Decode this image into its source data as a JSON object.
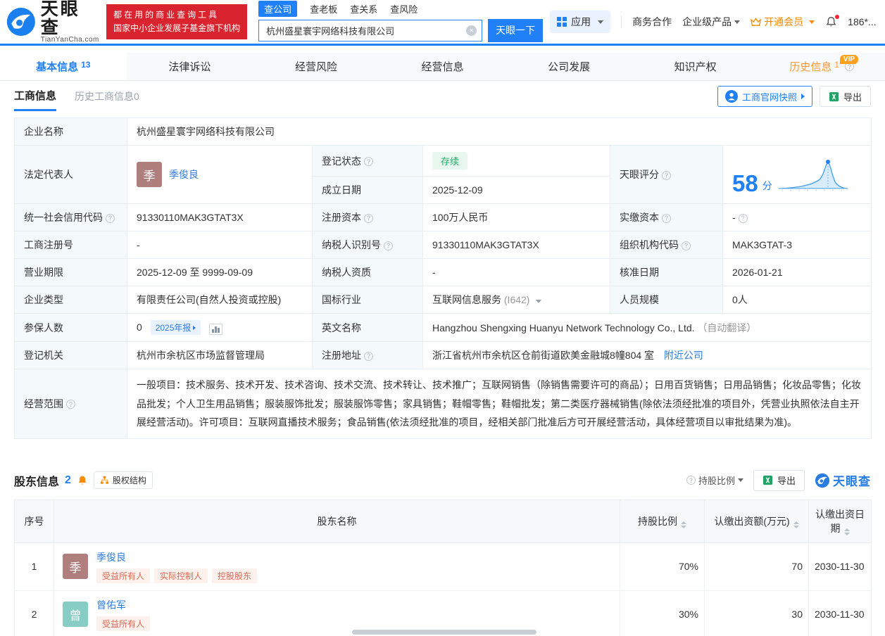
{
  "colors": {
    "primary_blue": "#2080f7",
    "link_blue": "#2d7ce0",
    "slogan_red": "#d9232e",
    "vip_orange": "#ff8a00",
    "status_green": "#21ac67",
    "avatar_brown": "#ae7f7c",
    "avatar_teal": "#87cdc6",
    "tag_orange": "#dd6a55"
  },
  "header": {
    "brand": "天眼查",
    "brand_domain": "TianYanCha.com",
    "slogan_line1": "都在用的商业查询工具",
    "slogan_line2": "国家中小企业发展子基金旗下机构",
    "search_tabs": [
      {
        "label": "查公司",
        "active": true
      },
      {
        "label": "查老板",
        "active": false
      },
      {
        "label": "查关系",
        "active": false
      },
      {
        "label": "查风险",
        "active": false
      }
    ],
    "search_value": "杭州盛星寰宇网络科技有限公司",
    "search_button": "天眼一下",
    "menu_apps": "应用",
    "menu_cooperation": "商务合作",
    "menu_enterprise": "企业级产品",
    "menu_vip": "开通会员",
    "user_phone": "186*..."
  },
  "tabs": [
    {
      "label": "基本信息",
      "count": "13"
    },
    {
      "label": "法律诉讼",
      "count": ""
    },
    {
      "label": "经营风险",
      "count": ""
    },
    {
      "label": "经营信息",
      "count": ""
    },
    {
      "label": "公司发展",
      "count": ""
    },
    {
      "label": "知识产权",
      "count": ""
    },
    {
      "label": "历史信息",
      "count": "1",
      "vip_badge": "VIP"
    }
  ],
  "subheader": {
    "tab_active": "工商信息",
    "tab_history": "历史工商信息0",
    "snapshot_button": "工商官网快照",
    "export_button": "导出"
  },
  "info": {
    "company_name_label": "企业名称",
    "company_name": "杭州盛星寰宇网络科技有限公司",
    "legal_rep_label": "法定代表人",
    "legal_rep_avatar": "季",
    "legal_rep_name": "季俊良",
    "reg_status_label": "登记状态",
    "reg_status": "存续",
    "score_label": "天眼评分",
    "score_value": "58",
    "score_unit": "分",
    "established_label": "成立日期",
    "established": "2025-12-09",
    "credit_code_label": "统一社会信用代码",
    "credit_code": "91330110MAK3GTAT3X",
    "reg_capital_label": "注册资本",
    "reg_capital": "100万人民币",
    "paid_capital_label": "实缴资本",
    "paid_capital": "-",
    "reg_number_label": "工商注册号",
    "reg_number": "-",
    "taxpayer_id_label": "纳税人识别号",
    "taxpayer_id": "91330110MAK3GTAT3X",
    "org_code_label": "组织机构代码",
    "org_code": "MAK3GTAT-3",
    "business_term_label": "营业期限",
    "business_term": "2025-12-09 至 9999-09-09",
    "taxpayer_qual_label": "纳税人资质",
    "taxpayer_qual": "-",
    "approved_date_label": "核准日期",
    "approved_date": "2026-01-21",
    "company_type_label": "企业类型",
    "company_type": "有限责任公司(自然人投资或控股)",
    "industry_label": "国标行业",
    "industry": "互联网信息服务",
    "industry_code": "(I642)",
    "staff_size_label": "人员规模",
    "staff_size": "0人",
    "insured_label": "参保人数",
    "insured_count": "0",
    "insured_tag": "2025年报",
    "english_name_label": "英文名称",
    "english_name": "Hangzhou Shengxing Huanyu Network Technology Co., Ltd.",
    "english_name_note": "（自动翻译）",
    "authority_label": "登记机关",
    "authority": "杭州市余杭区市场监督管理局",
    "address_label": "注册地址",
    "address": "浙江省杭州市余杭区仓前街道欧美金融城8幢804 室",
    "address_link": "附近公司",
    "scope_label": "经营范围",
    "scope": "一般项目：技术服务、技术开发、技术咨询、技术交流、技术转让、技术推广；互联网销售（除销售需要许可的商品）；日用百货销售；日用品销售；化妆品零售；化妆品批发；个人卫生用品销售；服装服饰批发；服装服饰零售；家具销售；鞋帽零售；鞋帽批发；第二类医疗器械销售(除依法须经批准的项目外，凭营业执照依法自主开展经营活动)。许可项目：互联网直播技术服务；食品销售(依法须经批准的项目，经相关部门批准后方可开展经营活动，具体经营项目以审批结果为准)。"
  },
  "shareholders": {
    "title": "股东信息",
    "count": "2",
    "structure_button": "股权结构",
    "ratio_filter": "持股比例",
    "export_button": "导出",
    "watermark": "天眼查",
    "columns": {
      "no": "序号",
      "name": "股东名称",
      "ratio": "持股比例",
      "amount": "认缴出资额(万元)",
      "date": "认缴出资日期"
    },
    "rows": [
      {
        "no": "1",
        "avatar": "季",
        "name": "季俊良",
        "tags": [
          "受益所有人",
          "实际控制人",
          "控股股东"
        ],
        "ratio": "70%",
        "amount": "70",
        "date": "2030-11-30"
      },
      {
        "no": "2",
        "avatar": "曾",
        "name": "曾佑军",
        "tags": [
          "受益所有人"
        ],
        "ratio": "30%",
        "amount": "30",
        "date": "2030-11-30"
      }
    ]
  }
}
